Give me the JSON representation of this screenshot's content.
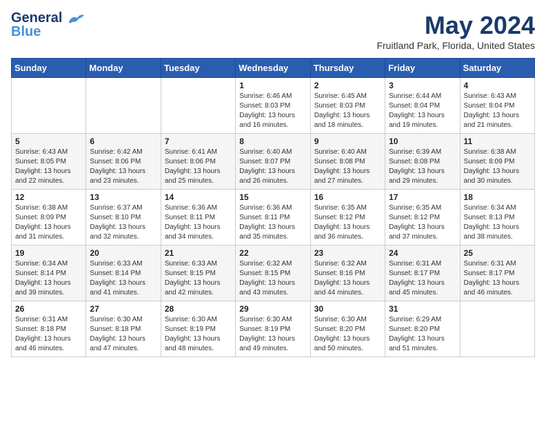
{
  "logo": {
    "line1": "General",
    "line2": "Blue"
  },
  "header": {
    "month_year": "May 2024",
    "location": "Fruitland Park, Florida, United States"
  },
  "weekdays": [
    "Sunday",
    "Monday",
    "Tuesday",
    "Wednesday",
    "Thursday",
    "Friday",
    "Saturday"
  ],
  "weeks": [
    [
      {
        "day": "",
        "info": ""
      },
      {
        "day": "",
        "info": ""
      },
      {
        "day": "",
        "info": ""
      },
      {
        "day": "1",
        "info": "Sunrise: 6:46 AM\nSunset: 8:03 PM\nDaylight: 13 hours\nand 16 minutes."
      },
      {
        "day": "2",
        "info": "Sunrise: 6:45 AM\nSunset: 8:03 PM\nDaylight: 13 hours\nand 18 minutes."
      },
      {
        "day": "3",
        "info": "Sunrise: 6:44 AM\nSunset: 8:04 PM\nDaylight: 13 hours\nand 19 minutes."
      },
      {
        "day": "4",
        "info": "Sunrise: 6:43 AM\nSunset: 8:04 PM\nDaylight: 13 hours\nand 21 minutes."
      }
    ],
    [
      {
        "day": "5",
        "info": "Sunrise: 6:43 AM\nSunset: 8:05 PM\nDaylight: 13 hours\nand 22 minutes."
      },
      {
        "day": "6",
        "info": "Sunrise: 6:42 AM\nSunset: 8:06 PM\nDaylight: 13 hours\nand 23 minutes."
      },
      {
        "day": "7",
        "info": "Sunrise: 6:41 AM\nSunset: 8:06 PM\nDaylight: 13 hours\nand 25 minutes."
      },
      {
        "day": "8",
        "info": "Sunrise: 6:40 AM\nSunset: 8:07 PM\nDaylight: 13 hours\nand 26 minutes."
      },
      {
        "day": "9",
        "info": "Sunrise: 6:40 AM\nSunset: 8:08 PM\nDaylight: 13 hours\nand 27 minutes."
      },
      {
        "day": "10",
        "info": "Sunrise: 6:39 AM\nSunset: 8:08 PM\nDaylight: 13 hours\nand 29 minutes."
      },
      {
        "day": "11",
        "info": "Sunrise: 6:38 AM\nSunset: 8:09 PM\nDaylight: 13 hours\nand 30 minutes."
      }
    ],
    [
      {
        "day": "12",
        "info": "Sunrise: 6:38 AM\nSunset: 8:09 PM\nDaylight: 13 hours\nand 31 minutes."
      },
      {
        "day": "13",
        "info": "Sunrise: 6:37 AM\nSunset: 8:10 PM\nDaylight: 13 hours\nand 32 minutes."
      },
      {
        "day": "14",
        "info": "Sunrise: 6:36 AM\nSunset: 8:11 PM\nDaylight: 13 hours\nand 34 minutes."
      },
      {
        "day": "15",
        "info": "Sunrise: 6:36 AM\nSunset: 8:11 PM\nDaylight: 13 hours\nand 35 minutes."
      },
      {
        "day": "16",
        "info": "Sunrise: 6:35 AM\nSunset: 8:12 PM\nDaylight: 13 hours\nand 36 minutes."
      },
      {
        "day": "17",
        "info": "Sunrise: 6:35 AM\nSunset: 8:12 PM\nDaylight: 13 hours\nand 37 minutes."
      },
      {
        "day": "18",
        "info": "Sunrise: 6:34 AM\nSunset: 8:13 PM\nDaylight: 13 hours\nand 38 minutes."
      }
    ],
    [
      {
        "day": "19",
        "info": "Sunrise: 6:34 AM\nSunset: 8:14 PM\nDaylight: 13 hours\nand 39 minutes."
      },
      {
        "day": "20",
        "info": "Sunrise: 6:33 AM\nSunset: 8:14 PM\nDaylight: 13 hours\nand 41 minutes."
      },
      {
        "day": "21",
        "info": "Sunrise: 6:33 AM\nSunset: 8:15 PM\nDaylight: 13 hours\nand 42 minutes."
      },
      {
        "day": "22",
        "info": "Sunrise: 6:32 AM\nSunset: 8:15 PM\nDaylight: 13 hours\nand 43 minutes."
      },
      {
        "day": "23",
        "info": "Sunrise: 6:32 AM\nSunset: 8:16 PM\nDaylight: 13 hours\nand 44 minutes."
      },
      {
        "day": "24",
        "info": "Sunrise: 6:31 AM\nSunset: 8:17 PM\nDaylight: 13 hours\nand 45 minutes."
      },
      {
        "day": "25",
        "info": "Sunrise: 6:31 AM\nSunset: 8:17 PM\nDaylight: 13 hours\nand 46 minutes."
      }
    ],
    [
      {
        "day": "26",
        "info": "Sunrise: 6:31 AM\nSunset: 8:18 PM\nDaylight: 13 hours\nand 46 minutes."
      },
      {
        "day": "27",
        "info": "Sunrise: 6:30 AM\nSunset: 8:18 PM\nDaylight: 13 hours\nand 47 minutes."
      },
      {
        "day": "28",
        "info": "Sunrise: 6:30 AM\nSunset: 8:19 PM\nDaylight: 13 hours\nand 48 minutes."
      },
      {
        "day": "29",
        "info": "Sunrise: 6:30 AM\nSunset: 8:19 PM\nDaylight: 13 hours\nand 49 minutes."
      },
      {
        "day": "30",
        "info": "Sunrise: 6:30 AM\nSunset: 8:20 PM\nDaylight: 13 hours\nand 50 minutes."
      },
      {
        "day": "31",
        "info": "Sunrise: 6:29 AM\nSunset: 8:20 PM\nDaylight: 13 hours\nand 51 minutes."
      },
      {
        "day": "",
        "info": ""
      }
    ]
  ]
}
